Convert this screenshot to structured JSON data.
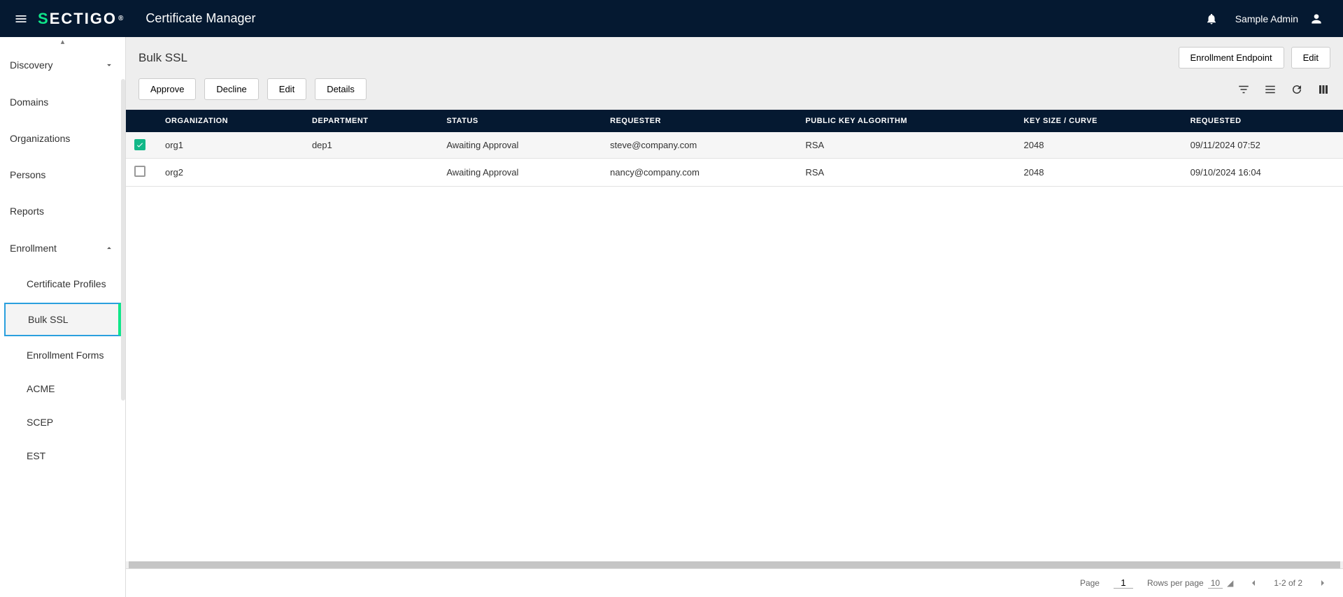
{
  "header": {
    "brand_s": "S",
    "brand_rest": "ECTIGO",
    "brand_reg": "®",
    "app_title": "Certificate Manager",
    "user": "Sample Admin"
  },
  "sidebar": {
    "items": [
      {
        "label": "Discovery",
        "expandable": true,
        "open": false
      },
      {
        "label": "Domains"
      },
      {
        "label": "Organizations"
      },
      {
        "label": "Persons"
      },
      {
        "label": "Reports"
      },
      {
        "label": "Enrollment",
        "expandable": true,
        "open": true
      }
    ],
    "enrollment_children": [
      {
        "label": "Certificate Profiles"
      },
      {
        "label": "Bulk SSL",
        "active": true
      },
      {
        "label": "Enrollment Forms"
      },
      {
        "label": "ACME"
      },
      {
        "label": "SCEP"
      },
      {
        "label": "EST"
      }
    ]
  },
  "page": {
    "title": "Bulk SSL",
    "header_buttons": {
      "enrollment_endpoint": "Enrollment Endpoint",
      "edit": "Edit"
    },
    "actions": {
      "approve": "Approve",
      "decline": "Decline",
      "edit": "Edit",
      "details": "Details"
    }
  },
  "table": {
    "columns": [
      "ORGANIZATION",
      "DEPARTMENT",
      "STATUS",
      "REQUESTER",
      "PUBLIC KEY ALGORITHM",
      "KEY SIZE / CURVE",
      "REQUESTED"
    ],
    "rows": [
      {
        "checked": true,
        "organization": "org1",
        "department": "dep1",
        "status": "Awaiting Approval",
        "requester": "steve@company.com",
        "pka": "RSA",
        "keysize": "2048",
        "requested": "09/11/2024 07:52"
      },
      {
        "checked": false,
        "organization": "org2",
        "department": "",
        "status": "Awaiting Approval",
        "requester": "nancy@company.com",
        "pka": "RSA",
        "keysize": "2048",
        "requested": "09/10/2024 16:04"
      }
    ]
  },
  "pager": {
    "page_label": "Page",
    "page": "1",
    "rows_label": "Rows per page",
    "rows_per_page": "10",
    "range": "1-2 of 2"
  }
}
